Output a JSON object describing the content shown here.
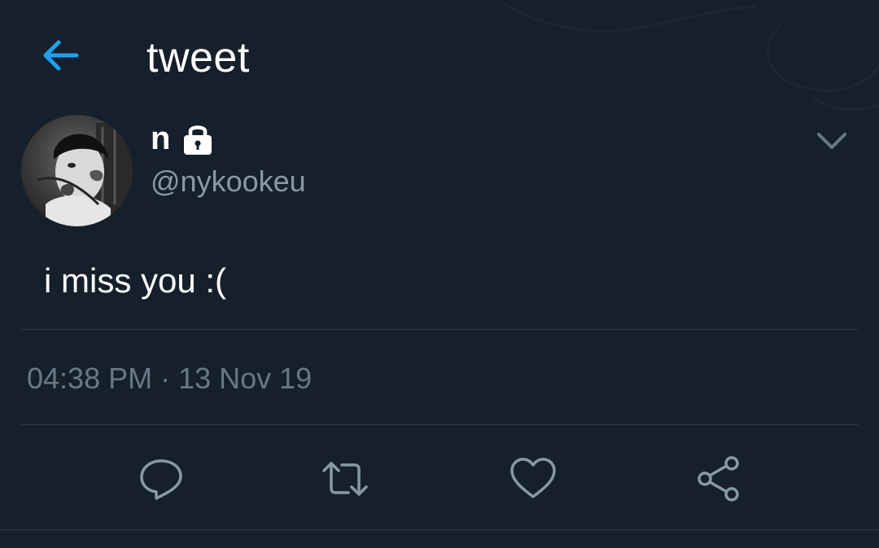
{
  "header": {
    "title": "tweet",
    "back_icon": "back-arrow-icon",
    "accent_color": "#1da1f2"
  },
  "tweet": {
    "user": {
      "name": "n",
      "handle": "@nykookeu",
      "protected_icon": "lock-icon"
    },
    "text": "i miss you :(",
    "timestamp": "04:38 PM · 13 Nov 19",
    "menu_icon": "chevron-down-icon"
  },
  "actions": [
    {
      "name": "reply",
      "icon": "reply-icon"
    },
    {
      "name": "retweet",
      "icon": "retweet-icon"
    },
    {
      "name": "like",
      "icon": "heart-icon"
    },
    {
      "name": "share",
      "icon": "share-icon"
    }
  ],
  "colors": {
    "background": "#16202b",
    "text_primary": "#ffffff",
    "text_secondary": "#8899a6",
    "icon_muted": "#8899a6",
    "divider": "#2f3b47"
  }
}
